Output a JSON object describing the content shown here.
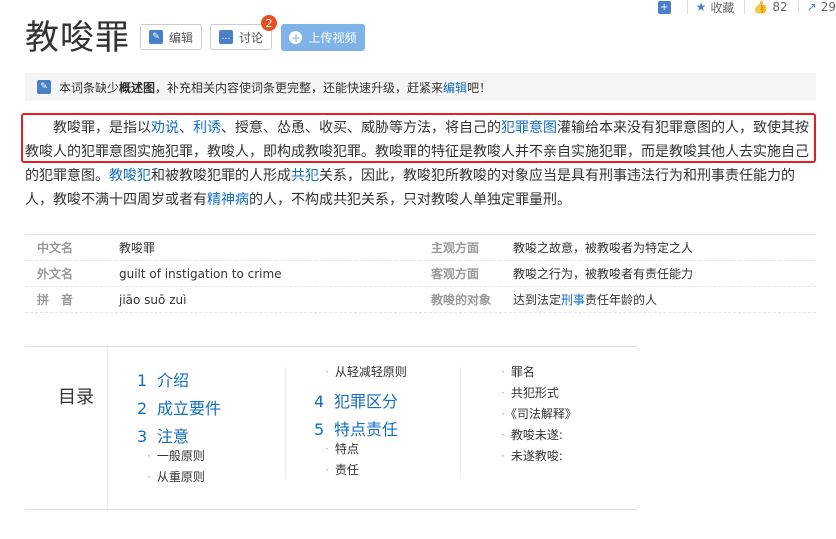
{
  "topbar": {
    "collect_label": "收藏",
    "like_count": "82",
    "share_count": "29"
  },
  "title": "教唆罪",
  "buttons": {
    "edit": "编辑",
    "discuss": "讨论",
    "discuss_badge": "2",
    "upload": "上传视频"
  },
  "notice": {
    "pre": "本词条缺少",
    "bold": "概述图",
    "mid": "，补充相关内容使词条更完整，还能快速升级，赶紧来",
    "link": "编辑",
    "post": "吧！"
  },
  "summary": {
    "s1": "教唆罪，是指以",
    "l1": "劝说",
    "s2": "、",
    "l2": "利诱",
    "s3": "、授意、怂恿、收买、威胁等方法，将自己的",
    "l3": "犯罪意图",
    "s4": "灌输给本来没有犯罪意图的人，致使其按教唆人的犯罪意图实施犯罪，教唆人，即构成教唆犯罪。教唆罪的特征是教唆人并不亲自实施犯罪，而是教唆其他人去实施自己的犯罪意图。",
    "l4": "教唆犯",
    "s5": "和被教唆犯罪的人形成",
    "l5": "共犯",
    "s6": "关系，因此，教唆犯所教唆的对象应当是具有刑事违法行为和刑事责任能力的人，教唆不满十四周岁或者有",
    "l6": "精神病",
    "s7": "的人，不构成共犯关系，只对教唆人单独定罪量刑。"
  },
  "info": {
    "rows": [
      {
        "k1": "中文名",
        "v1": "教唆罪",
        "k2": "主观方面",
        "v2": "教唆之故意，被教唆者为特定之人"
      },
      {
        "k1": "外文名",
        "v1": "guilt of instigation to crime",
        "k2": "客观方面",
        "v2": "教唆之行为，被教唆者有责任能力"
      },
      {
        "k1": "拼　音",
        "v1": "jiāo suō zuì",
        "k2": "教唆的对象",
        "v2_pre": "达到法定",
        "v2_link": "刑事",
        "v2_post": "责任年龄的人"
      }
    ]
  },
  "catalog": {
    "title": "目录",
    "col1": [
      {
        "num": "1",
        "label": "介绍"
      },
      {
        "num": "2",
        "label": "成立要件"
      },
      {
        "num": "3",
        "label": "注意"
      }
    ],
    "col1_sub": [
      "一般原则",
      "从重原则"
    ],
    "col2_top": "从轻减轻原则",
    "col2": [
      {
        "num": "4",
        "label": "犯罪区分"
      },
      {
        "num": "5",
        "label": "特点责任"
      }
    ],
    "col2_sub": [
      "特点",
      "责任"
    ],
    "col3": [
      "罪名",
      "共犯形式",
      "《司法解释》",
      "教唆未遂:",
      "未遂教唆:"
    ]
  }
}
